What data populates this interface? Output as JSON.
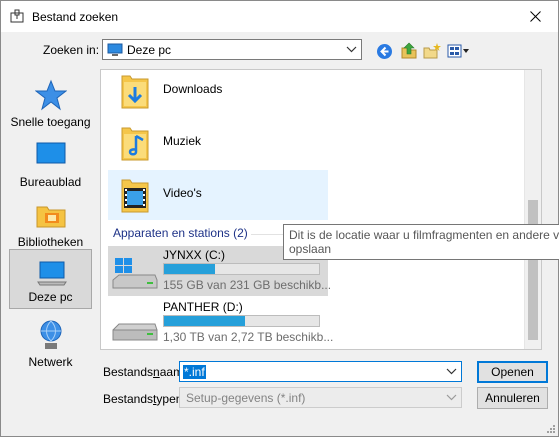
{
  "window": {
    "title": "Bestand zoeken"
  },
  "lookin": {
    "label": "Zoeken in:",
    "value": "Deze pc"
  },
  "toolbar": {
    "icons": [
      "back-icon",
      "up-folder-icon",
      "new-folder-icon",
      "view-menu-icon"
    ]
  },
  "places": [
    {
      "label": "Snelle toegang",
      "icon": "star-icon"
    },
    {
      "label": "Bureaublad",
      "icon": "desktop-icon"
    },
    {
      "label": "Bibliotheken",
      "icon": "libraries-icon"
    },
    {
      "label": "Deze pc",
      "icon": "computer-icon",
      "selected": true
    },
    {
      "label": "Netwerk",
      "icon": "network-icon"
    }
  ],
  "folders": [
    {
      "name": "Downloads",
      "icon": "downloads-folder-icon"
    },
    {
      "name": "Muziek",
      "icon": "music-folder-icon"
    },
    {
      "name": "Video's",
      "icon": "videos-folder-icon",
      "hover": true
    }
  ],
  "devices": {
    "header": "Apparaten en stations (2)",
    "drives": [
      {
        "name": "JYNXX (C:)",
        "info": "155 GB van 231 GB beschikb...",
        "used_fraction": 0.33,
        "selected": true
      },
      {
        "name": "PANTHER (D:)",
        "info": "1,30 TB van 2,72 TB beschikb...",
        "used_fraction": 0.52
      }
    ]
  },
  "tooltip": {
    "line1": "Dit is de locatie waar u filmfragmenten en andere vi",
    "line2": "opslaan"
  },
  "filename": {
    "label_pre": "Bestands",
    "label_accel": "n",
    "label_post": "aam:",
    "value": "*.inf"
  },
  "filetype": {
    "label_pre": "Bestands",
    "label_accel": "t",
    "label_post": "ypen:",
    "value": "Setup-gegevens (*.inf)"
  },
  "buttons": {
    "open": "Openen",
    "cancel": "Annuleren"
  },
  "colors": {
    "accent": "#0078d7",
    "bar": "#26a0da",
    "group_header": "#1e3287"
  }
}
